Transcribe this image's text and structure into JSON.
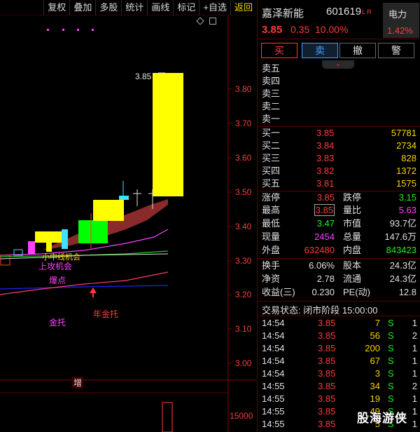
{
  "toolbar": {
    "items": [
      "复权",
      "叠加",
      "多股",
      "统计",
      "画线",
      "标记",
      "+自选",
      "返回"
    ]
  },
  "chart": {
    "y_ticks": [
      "3.80",
      "3.70",
      "3.60",
      "3.50",
      "3.40",
      "3.30",
      "3.20",
      "3.10",
      "3.00"
    ],
    "volume_tick": "15000",
    "high_label": "3.85",
    "annotations": {
      "small_trend": "小中线机会",
      "attack": "上攻机会",
      "burst": "爆点",
      "gold": "金托",
      "year_gold": "年金托",
      "increase": "增"
    },
    "colors": {
      "up": "#ff3b3b",
      "limit_candle": "#ffff00",
      "green_candle": "#00ff00",
      "cyan": "#40e0ff"
    }
  },
  "stock": {
    "name": "嘉泽新能",
    "code": "601619",
    "lr": "L R",
    "price": "3.85",
    "change": "0.35",
    "change_pct": "10.00%",
    "sector": "电力",
    "sector_pct": "1.42%"
  },
  "actions": {
    "buy": "买",
    "sell": "卖",
    "cancel": "撤",
    "alert": "警",
    "collapse": "⌄"
  },
  "asks": [
    {
      "label": "卖五"
    },
    {
      "label": "卖四"
    },
    {
      "label": "卖三"
    },
    {
      "label": "卖二"
    },
    {
      "label": "卖一"
    }
  ],
  "bids": [
    {
      "label": "买一",
      "price": "3.85",
      "vol": "57781"
    },
    {
      "label": "买二",
      "price": "3.84",
      "vol": "2734"
    },
    {
      "label": "买三",
      "price": "3.83",
      "vol": "828"
    },
    {
      "label": "买四",
      "price": "3.82",
      "vol": "1372"
    },
    {
      "label": "买五",
      "price": "3.81",
      "vol": "1575"
    }
  ],
  "stats": [
    {
      "k1": "涨停",
      "v1": "3.85",
      "c1": "red",
      "k2": "跌停",
      "v2": "3.15",
      "c2": "green"
    },
    {
      "k1": "最高",
      "v1": "3.85",
      "c1": "red",
      "k2": "量比",
      "v2": "5.63",
      "c2": "mag"
    },
    {
      "k1": "最低",
      "v1": "3.47",
      "c1": "green",
      "k2": "市值",
      "v2": "93.7亿",
      "c2": "white"
    },
    {
      "k1": "现量",
      "v1": "2454",
      "c1": "mag",
      "k2": "总量",
      "v2": "147.6万",
      "c2": "white"
    },
    {
      "k1": "外盘",
      "v1": "632480",
      "c1": "red",
      "k2": "内盘",
      "v2": "843423",
      "c2": "green"
    }
  ],
  "stats2": [
    {
      "k1": "换手",
      "v1": "6.06%",
      "k2": "股本",
      "v2": "24.3亿"
    },
    {
      "k1": "净资",
      "v1": "2.78",
      "k2": "流通",
      "v2": "24.3亿"
    },
    {
      "k1": "收益(三)",
      "v1": "0.230",
      "k2": "PE(动)",
      "v2": "12.8"
    }
  ],
  "trade_status": "交易状态: 闭市阶段 15:00:00",
  "ticks": [
    {
      "t": "14:54",
      "p": "3.85",
      "v": "7",
      "s": "S",
      "n": "1"
    },
    {
      "t": "14:54",
      "p": "3.85",
      "v": "56",
      "s": "S",
      "n": "2"
    },
    {
      "t": "14:54",
      "p": "3.85",
      "v": "200",
      "s": "S",
      "n": "1"
    },
    {
      "t": "14:54",
      "p": "3.85",
      "v": "67",
      "s": "S",
      "n": "1"
    },
    {
      "t": "14:54",
      "p": "3.85",
      "v": "3",
      "s": "S",
      "n": "1"
    },
    {
      "t": "14:55",
      "p": "3.85",
      "v": "34",
      "s": "S",
      "n": "2"
    },
    {
      "t": "14:55",
      "p": "3.85",
      "v": "19",
      "s": "S",
      "n": "1"
    },
    {
      "t": "14:55",
      "p": "3.85",
      "v": "49",
      "s": "S",
      "n": "1"
    },
    {
      "t": "14:55",
      "p": "3.85",
      "v": "5",
      "s": "S",
      "n": "1"
    }
  ],
  "watermark": "股海游侠"
}
